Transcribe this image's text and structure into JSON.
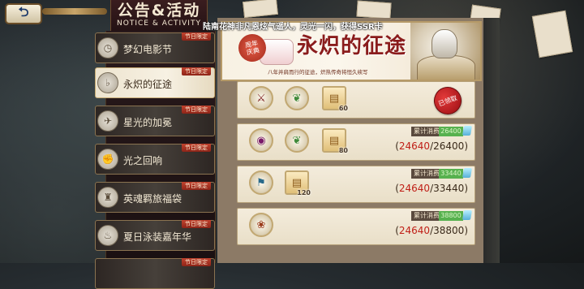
{
  "header": {
    "title": "公告&活动",
    "subtitle": "NOTICE & ACTIVITY"
  },
  "ticker": "陆南花神非凡恩炫气遥人，灵光一闪，获得SSR卡",
  "sidebar": {
    "badge": "节日限定",
    "items": [
      {
        "label": "梦幻电影节",
        "icon": "clock-icon"
      },
      {
        "label": "永炽的征途",
        "icon": "horn-icon",
        "active": true
      },
      {
        "label": "星光的加冕",
        "icon": "wing-icon"
      },
      {
        "label": "光之回响",
        "icon": "fist-icon"
      },
      {
        "label": "英魂羁旅福袋",
        "icon": "bag-icon"
      },
      {
        "label": "夏日泳装嘉年华",
        "icon": "bottle-icon"
      }
    ]
  },
  "banner": {
    "badge": "周年\n庆典",
    "title": "永炽的征途",
    "subtitle": "八年并肩而行的征途，炽热传奇将恒久续写"
  },
  "rewards": [
    {
      "items": [
        {
          "icon": "sword-icon",
          "count": ""
        },
        {
          "icon": "wreath-icon",
          "count": ""
        },
        {
          "icon": "scroll-icon",
          "count": "60"
        }
      ],
      "claimed": true,
      "stamp": "已领取"
    },
    {
      "items": [
        {
          "icon": "orb-icon",
          "count": ""
        },
        {
          "icon": "wreath-icon",
          "count": ""
        },
        {
          "icon": "scroll-icon",
          "count": "80"
        }
      ],
      "label": "累计消费",
      "need": "26400",
      "current": "24640",
      "target": "26400"
    },
    {
      "items": [
        {
          "icon": "banner-icon",
          "count": ""
        },
        {
          "icon": "scroll-icon",
          "count": "120"
        }
      ],
      "label": "累计消费",
      "need": "33440",
      "current": "24640",
      "target": "33440"
    },
    {
      "items": [
        {
          "icon": "gift-icon",
          "count": ""
        }
      ],
      "label": "累计消费",
      "need": "38800",
      "current": "24640",
      "target": "38800"
    }
  ],
  "colors": {
    "accent": "#8a1c1c",
    "progress_current": "#c02018",
    "need_bg": "#57b14f"
  }
}
